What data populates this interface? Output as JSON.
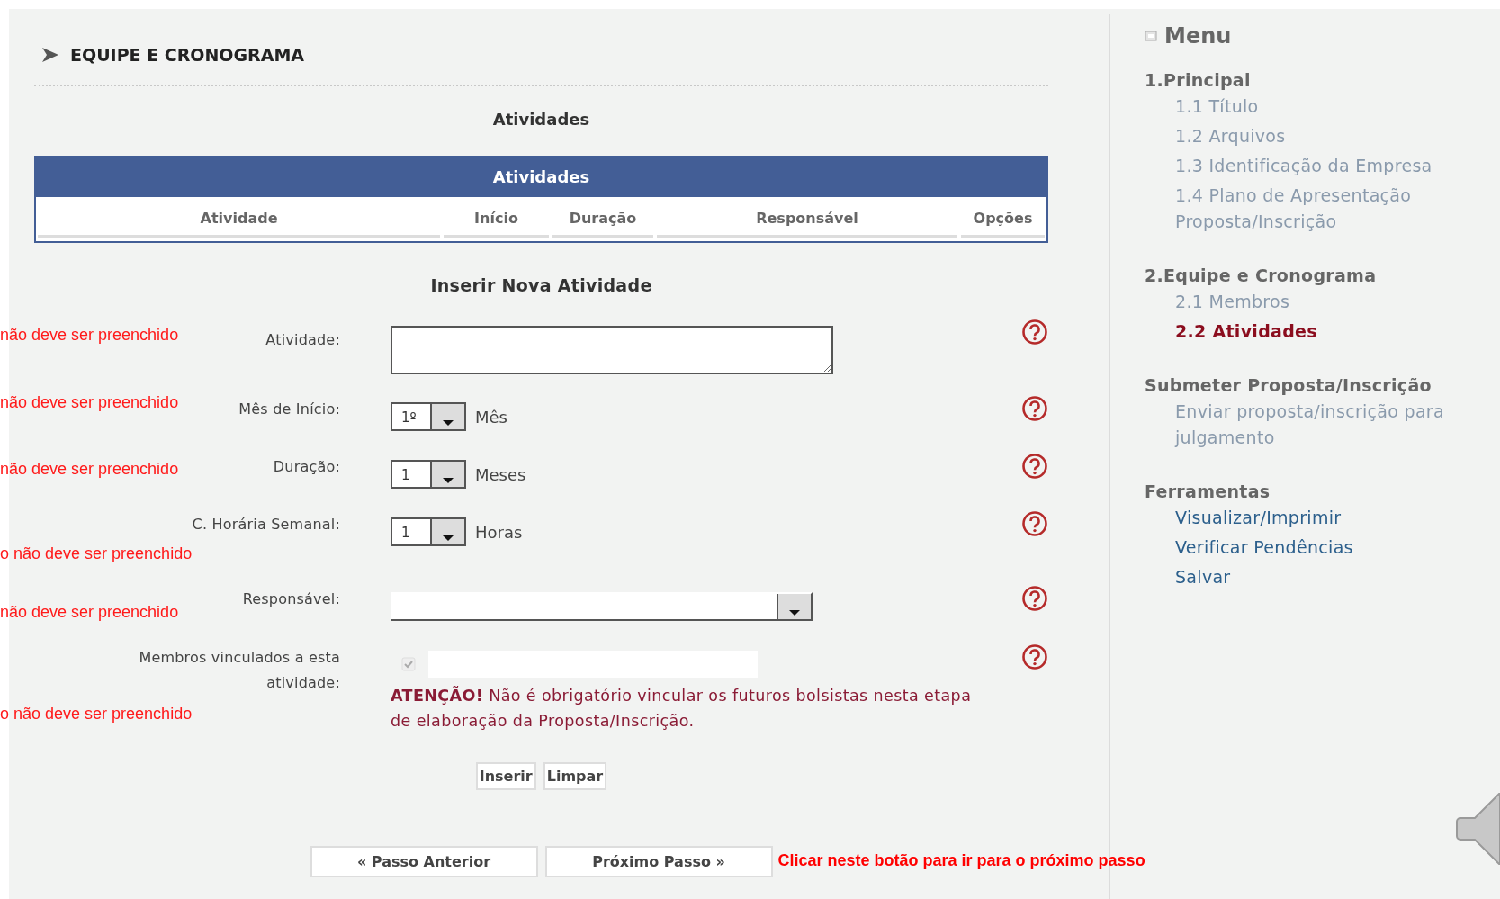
{
  "section_title": "EQUIPE E CRONOGRAMA",
  "subtitle": "Atividades",
  "table": {
    "title": "Atividades",
    "columns": [
      "Atividade",
      "Início",
      "Duração",
      "Responsável",
      "Opções"
    ]
  },
  "form": {
    "title": "Inserir Nova Atividade",
    "fields": [
      {
        "kind": "textarea",
        "label": "Atividade:",
        "annotation": "não deve ser preenchido"
      },
      {
        "kind": "select",
        "label": "Mês de Início:",
        "value": "1º",
        "unit": "Mês",
        "annotation": "não deve ser preenchido"
      },
      {
        "kind": "select",
        "label": "Duração:",
        "value": "1",
        "unit": "Meses",
        "annotation": "não deve ser preenchido"
      },
      {
        "kind": "select",
        "label": "C. Horária Semanal:",
        "value": "1",
        "unit": "Horas",
        "annotation": "o não deve ser preenchido"
      },
      {
        "kind": "wide-select",
        "label": "Responsável:",
        "annotation": "não deve ser preenchido"
      },
      {
        "kind": "members",
        "label": "Membros vinculados a esta atividade:",
        "checked": true,
        "disabled": true,
        "annotation": "o não deve ser preenchido",
        "notice": "**ATENÇÃO!** Não é obrigatório vincular os futuros bolsistas nesta etapa de elaboração da Proposta/Inscrição."
      }
    ],
    "buttons": [
      "Inserir",
      "Limpar"
    ]
  },
  "navigation": {
    "buttons": [
      "« Passo Anterior",
      "Próximo Passo »"
    ],
    "annotation": "Clicar neste botão para ir para o próximo passo"
  },
  "menu": {
    "title": "Menu",
    "sections": [
      {
        "title": "1.Principal",
        "kind": "steps",
        "items": [
          {
            "label": "1.1 Título",
            "selected": false
          },
          {
            "label": "1.2 Arquivos",
            "selected": false
          },
          {
            "label": "1.3 Identificação da Empresa",
            "selected": false
          },
          {
            "label": "1.4 Plano de Apresentação Proposta/Inscrição",
            "selected": false
          }
        ]
      },
      {
        "title": "2.Equipe e Cronograma",
        "kind": "steps",
        "items": [
          {
            "label": "2.1 Membros",
            "selected": false
          },
          {
            "label": "2.2 Atividades",
            "selected": true
          }
        ]
      },
      {
        "title": "Submeter Proposta/Inscrição",
        "kind": "steps",
        "items": [
          {
            "label": "Enviar proposta/inscrição para julgamento",
            "selected": false
          }
        ]
      },
      {
        "title": "Ferramentas",
        "kind": "tools",
        "items": [
          {
            "label": "Visualizar/Imprimir",
            "selected": false
          },
          {
            "label": "Verificar Pendências",
            "selected": false
          },
          {
            "label": "Salvar",
            "selected": false
          }
        ]
      }
    ]
  }
}
